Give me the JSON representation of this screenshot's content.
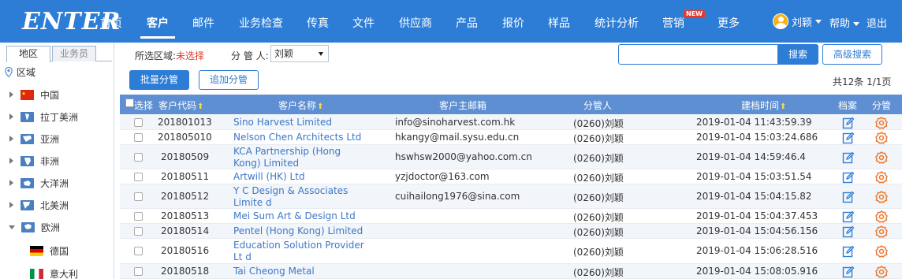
{
  "header": {
    "logo": "ENTER",
    "nav": [
      "首页",
      "客户",
      "邮件",
      "业务检查",
      "传真",
      "文件",
      "供应商",
      "产品",
      "报价",
      "样品",
      "统计分析",
      "营销",
      "更多"
    ],
    "new_badge": "NEW",
    "user_name": "刘颖",
    "help_label": "帮助",
    "logout_label": "退出"
  },
  "sidebar": {
    "tabs": [
      "地区",
      "业务员"
    ],
    "region_title": "区域",
    "items": [
      {
        "label": "中国",
        "icon": "china-flag-icon"
      },
      {
        "label": "拉丁美洲",
        "icon": "latin-america-icon"
      },
      {
        "label": "亚洲",
        "icon": "asia-icon"
      },
      {
        "label": "非洲",
        "icon": "africa-icon"
      },
      {
        "label": "大洋洲",
        "icon": "oceania-icon"
      },
      {
        "label": "北美洲",
        "icon": "north-america-icon"
      },
      {
        "label": "欧洲",
        "icon": "europe-icon"
      },
      {
        "label": "德国",
        "icon": "germany-flag-icon"
      },
      {
        "label": "意大利",
        "icon": "italy-flag-icon"
      }
    ]
  },
  "filters": {
    "area_label": "所选区域:",
    "area_value": "未选择",
    "manager_label": "分 管 人:",
    "manager_value": "刘颖",
    "search_placeholder": "",
    "search_button": "搜索",
    "advanced_button": "高级搜索"
  },
  "actions": {
    "batch_assign": "批量分管",
    "add_assign": "追加分管",
    "total": "共12条 1/1页"
  },
  "table": {
    "headers": [
      "选择",
      "客户代码",
      "客户名称",
      "客户主邮箱",
      "分管人",
      "建档时间",
      "档案",
      "分管"
    ],
    "rows": [
      {
        "code": "201801013",
        "name": "Sino Harvest Limited",
        "email": "info@sinoharvest.com.hk",
        "manager": "(0260)刘颖",
        "time": "2019-01-04 11:43:59.39"
      },
      {
        "code": "201805010",
        "name": "Nelson Chen Architects Ltd",
        "email": "hkangy@mail.sysu.edu.cn",
        "manager": "(0260)刘颖",
        "time": "2019-01-04 15:03:24.686"
      },
      {
        "code": "20180509",
        "name": "KCA Partnership (Hong Kong) Limited",
        "email": "hswhsw2000@yahoo.com.cn",
        "manager": "(0260)刘颖",
        "time": "2019-01-04 14:59:46.4"
      },
      {
        "code": "20180511",
        "name": "Artwill (HK) Ltd",
        "email": "yzjdoctor@163.com",
        "manager": "(0260)刘颖",
        "time": "2019-01-04 15:03:51.54"
      },
      {
        "code": "20180512",
        "name": "Y C Design & Associates Limite d",
        "email": "cuihailong1976@sina.com",
        "manager": "(0260)刘颖",
        "time": "2019-01-04 15:04:15.82"
      },
      {
        "code": "20180513",
        "name": "Mei Sum Art & Design Ltd",
        "email": "",
        "manager": "(0260)刘颖",
        "time": "2019-01-04 15:04:37.453"
      },
      {
        "code": "20180514",
        "name": "Pentel (Hong Kong) Limited",
        "email": "",
        "manager": "(0260)刘颖",
        "time": "2019-01-04 15:04:56.156"
      },
      {
        "code": "20180516",
        "name": "Education Solution Provider Lt d",
        "email": "",
        "manager": "(0260)刘颖",
        "time": "2019-01-04 15:06:28.516"
      },
      {
        "code": "20180518",
        "name": "Tai Cheong Metal Manufactory",
        "email": "",
        "manager": "(0260)刘颖",
        "time": "2019-01-04 15:08:05.916"
      }
    ]
  },
  "colors": {
    "primary": "#2d7dd6",
    "table_header": "#5d8fd2",
    "link": "#3b78c8",
    "alert": "#e03a2c",
    "gear": "#f0772b"
  }
}
